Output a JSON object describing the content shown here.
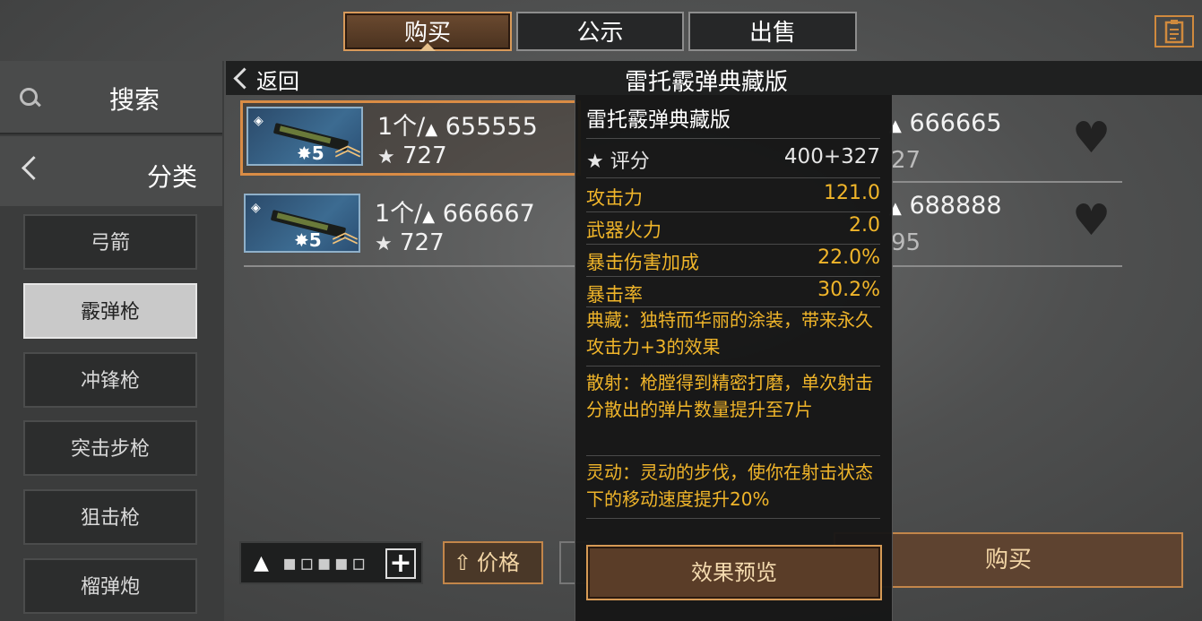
{
  "tabs": [
    {
      "label": "购买",
      "active": true
    },
    {
      "label": "公示",
      "active": false
    },
    {
      "label": "出售",
      "active": false
    }
  ],
  "sidebar": {
    "search_label": "搜索",
    "category_label": "分类",
    "categories": [
      {
        "label": "弓箭",
        "selected": false
      },
      {
        "label": "霰弹枪",
        "selected": true
      },
      {
        "label": "冲锋枪",
        "selected": false
      },
      {
        "label": "突击步枪",
        "selected": false
      },
      {
        "label": "狙击枪",
        "selected": false
      },
      {
        "label": "榴弹炮",
        "selected": false
      }
    ]
  },
  "detail": {
    "back_label": "返回",
    "title": "雷托霰弹典藏版"
  },
  "listings": [
    {
      "quantity_price": "1个/",
      "price": "655555",
      "score": "727",
      "level": "5"
    },
    {
      "quantity_price": "1个/",
      "price": "666667",
      "score": "727",
      "level": "5"
    }
  ],
  "listings_right": [
    {
      "price": "666665",
      "score_partial": "27"
    },
    {
      "price": "688888",
      "score_partial": "95"
    }
  ],
  "tooltip": {
    "title": "雷托霰弹典藏版",
    "rating_label": "评分",
    "rating_value": "400+327",
    "stats": [
      {
        "label": "攻击力",
        "value": "121.0"
      },
      {
        "label": "武器火力",
        "value": "2.0"
      },
      {
        "label": "暴击伤害加成",
        "value": "22.0%"
      },
      {
        "label": "暴击率",
        "value": "30.2%"
      }
    ],
    "perks": [
      "典藏：独特而华丽的涂装，带来永久攻击力+3的效果",
      "散射：枪膛得到精密打磨，单次射击分散出的弹片数量提升至7片",
      "灵动：灵动的步伐，使你在射击状态下的移动速度提升20%"
    ],
    "preview_label": "效果预览"
  },
  "bottom": {
    "price_sort_label": "价格",
    "buy_label": "购买"
  },
  "colors": {
    "accent_orange": "#d98c45",
    "stat_gold": "#f0b52a",
    "selected_category_bg": "#c9c9c9"
  },
  "icons": [
    "search-icon",
    "chevron-left-icon",
    "clipboard-icon",
    "diamond-icon",
    "rank-chevron-icon",
    "star-check-icon",
    "silver-coin-icon",
    "heart-icon",
    "plus-icon",
    "arrow-up-icon"
  ]
}
